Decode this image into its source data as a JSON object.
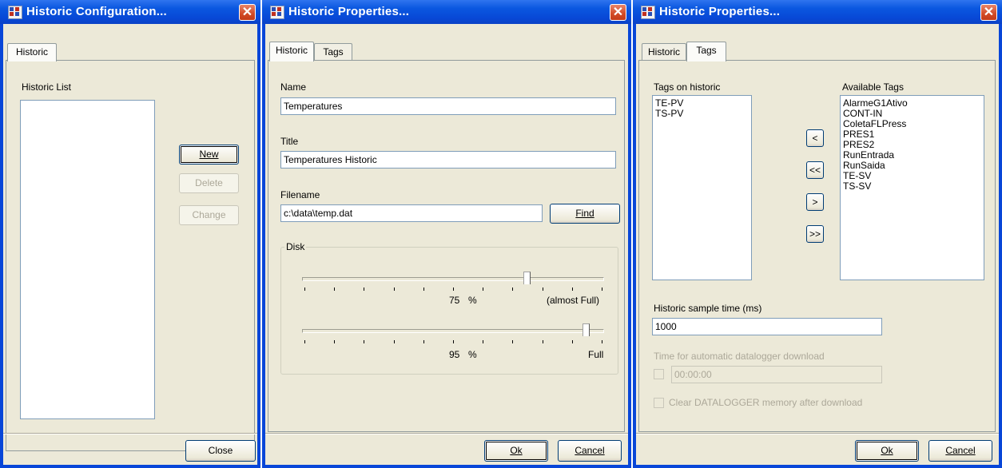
{
  "colors": {
    "titlebar": "#0a57e0",
    "face": "#ece9d8",
    "close": "#d24a26",
    "disabled": "#aca899"
  },
  "win1": {
    "title": "Historic Configuration...",
    "icon": "historic-app-icon",
    "close_glyph": "✕",
    "tabs": [
      {
        "label": "Historic"
      }
    ],
    "list_label": "Historic List",
    "buttons": {
      "new": "New",
      "delete": "Delete",
      "change": "Change",
      "close": "Close"
    }
  },
  "win2": {
    "title": "Historic Properties...",
    "icon": "historic-app-icon",
    "close_glyph": "✕",
    "tabs": [
      {
        "label": "Historic"
      },
      {
        "label": "Tags"
      }
    ],
    "name_label": "Name",
    "name_value": "Temperatures",
    "title_label": "Title",
    "title_value": "Temperatures Historic",
    "filename_label": "Filename",
    "filename_value": "c:\\data\\temp.dat",
    "find_label": "Find",
    "disk": {
      "label": "Disk",
      "slider1": {
        "value": 75,
        "value_text": "75",
        "unit": "%",
        "caption": "(almost Full)"
      },
      "slider2": {
        "value": 95,
        "value_text": "95",
        "unit": "%",
        "caption": "Full"
      }
    },
    "ok_label": "Ok",
    "cancel_label": "Cancel"
  },
  "win3": {
    "title": "Historic Properties...",
    "icon": "historic-app-icon",
    "close_glyph": "✕",
    "tabs": [
      {
        "label": "Historic"
      },
      {
        "label": "Tags"
      }
    ],
    "tags_on_label": "Tags on historic",
    "tags_on": [
      "TE-PV",
      "TS-PV"
    ],
    "available_label": "Available Tags",
    "available": [
      "AlarmeG1Ativo",
      "CONT-IN",
      "ColetaFLPress",
      "PRES1",
      "PRES2",
      "RunEntrada",
      "RunSaida",
      "TE-SV",
      "TS-SV"
    ],
    "move_buttons": [
      "<",
      "<<",
      ">",
      ">>"
    ],
    "sample_label": "Historic sample time (ms)",
    "sample_value": "1000",
    "auto_label": "Time for automatic datalogger download",
    "auto_value": "00:00:00",
    "clear_label": "Clear DATALOGGER memory after download",
    "ok_label": "Ok",
    "cancel_label": "Cancel"
  }
}
